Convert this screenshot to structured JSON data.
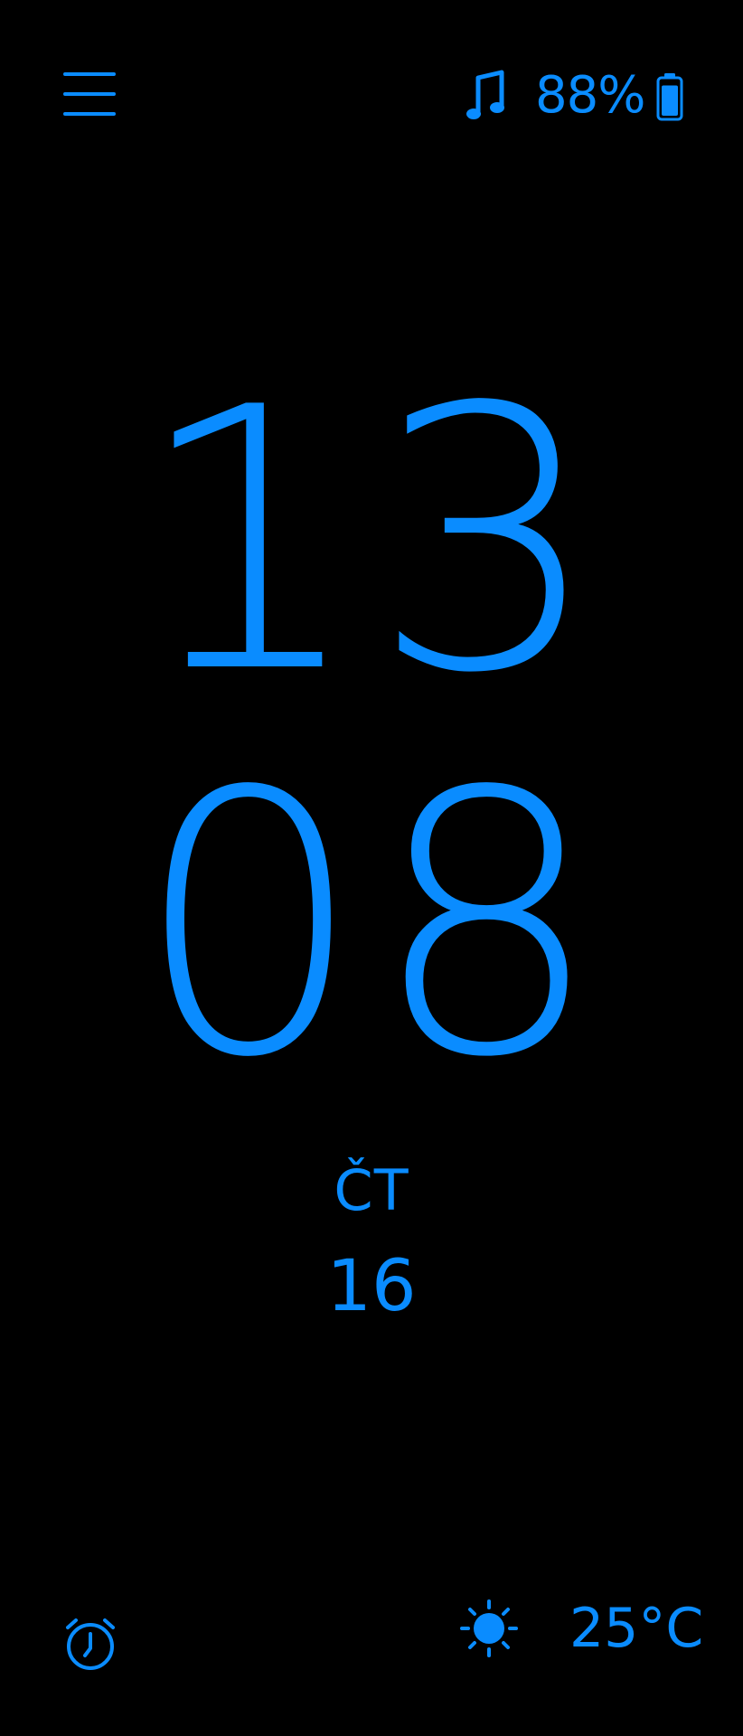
{
  "colors": {
    "background": "#000000",
    "accent": "#0A8CFF"
  },
  "status_bar": {
    "menu_icon": "hamburger-menu-icon",
    "music_icon": "music-note-icon",
    "battery_percent": "88%",
    "battery_icon": "battery-icon",
    "battery_level": 0.88
  },
  "clock": {
    "hours": "13",
    "minutes": "08"
  },
  "date": {
    "weekday": "ČT",
    "day": "16"
  },
  "bottom_bar": {
    "alarm_icon": "alarm-clock-icon",
    "weather_icon": "sun-icon",
    "temperature": "25°C"
  }
}
